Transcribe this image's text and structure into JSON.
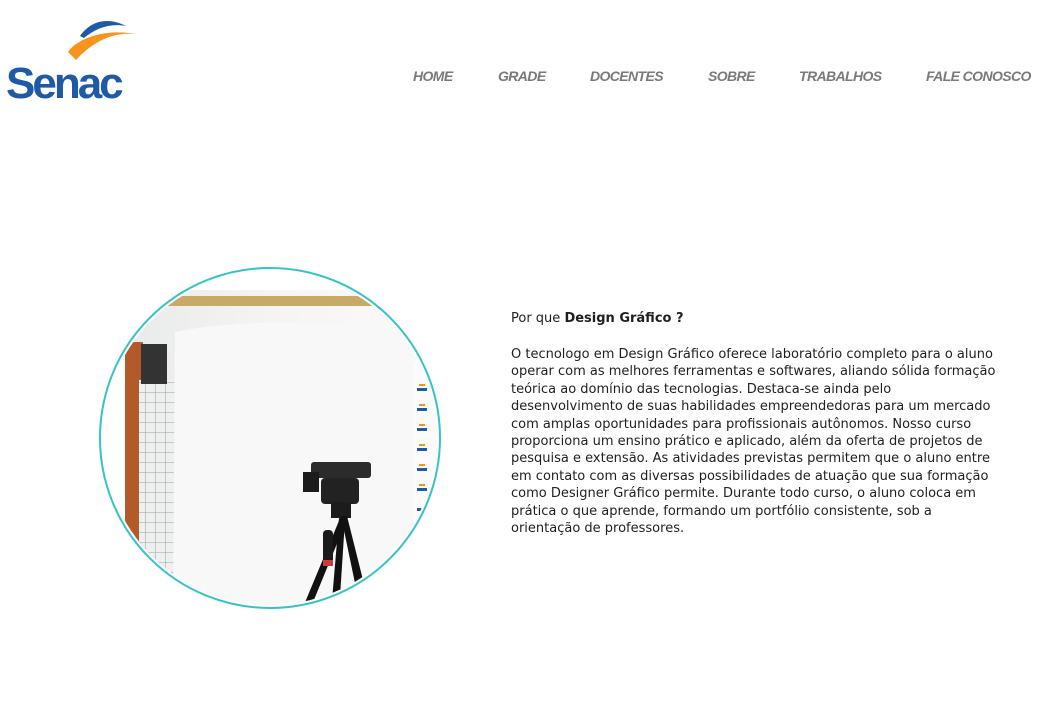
{
  "brand": {
    "logo_text": "Senac",
    "logo_colors": {
      "wordmark": "#1f5aa6",
      "swoosh_orange": "#f7941d",
      "swoosh_blue": "#1f5aa6"
    }
  },
  "nav": {
    "items": [
      {
        "label": "HOME"
      },
      {
        "label": "GRADE"
      },
      {
        "label": "DOCENTES"
      },
      {
        "label": "SOBRE"
      },
      {
        "label": "TRABALHOS"
      },
      {
        "label": "FALE CONOSCO"
      }
    ]
  },
  "hero": {
    "ring_color": "#35c3c8"
  },
  "section": {
    "heading_prefix": "Por que ",
    "heading_bold": "Design Gráfico ?",
    "paragraph": "O tecnologo em Design Gráfico oferece laboratório completo para o aluno operar com as melhores ferramentas e softwares, aliando sólida formação teórica ao domínio das tecnologias. Destaca-se ainda pelo desenvolvimento de suas habilidades empreendedoras para um mercado com amplas oportunidades para profissionais autônomos. Nosso curso proporciona um ensino prático e aplicado, além da oferta de projetos de pesquisa e extensão. As atividades previstas permitem que o aluno entre em contato com as diversas possibilidades de atuação que sua formação como Designer Gráfico permite. Durante todo curso, o aluno coloca em prática o que aprende, formando um portfólio consistente, sob a orientação de professores."
  }
}
